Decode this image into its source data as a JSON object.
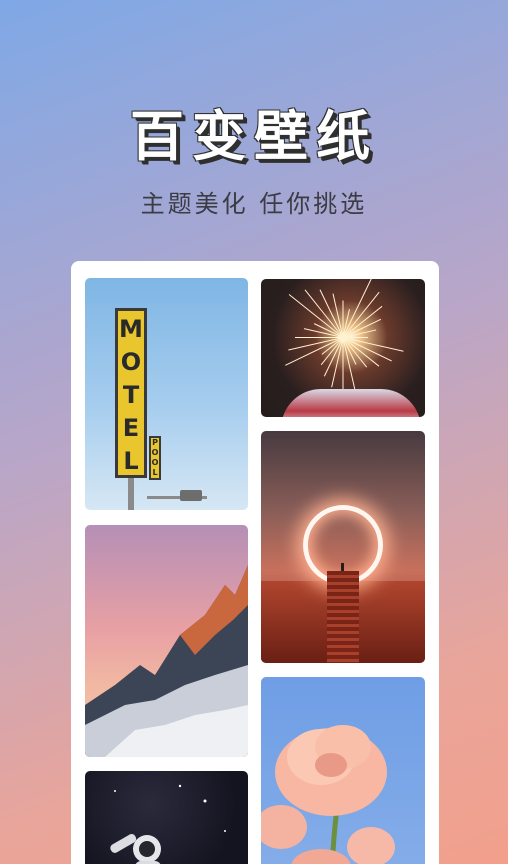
{
  "header": {
    "title": "百变壁纸",
    "subtitle": "主题美化 任你挑选"
  },
  "gallery": {
    "wallpapers": [
      {
        "name": "motel-sign",
        "sign_text": "MOTEL",
        "sub_sign_text": "POOL"
      },
      {
        "name": "sparkler"
      },
      {
        "name": "mountain-sunset"
      },
      {
        "name": "glowing-portal"
      },
      {
        "name": "peach-rose"
      },
      {
        "name": "astronaut"
      }
    ]
  },
  "colors": {
    "bg_top": "#7fa8e6",
    "bg_bottom": "#f2a08c",
    "title_fill": "#ffffff",
    "title_outline": "#2f2f2f",
    "subtitle": "#3c3c44"
  }
}
